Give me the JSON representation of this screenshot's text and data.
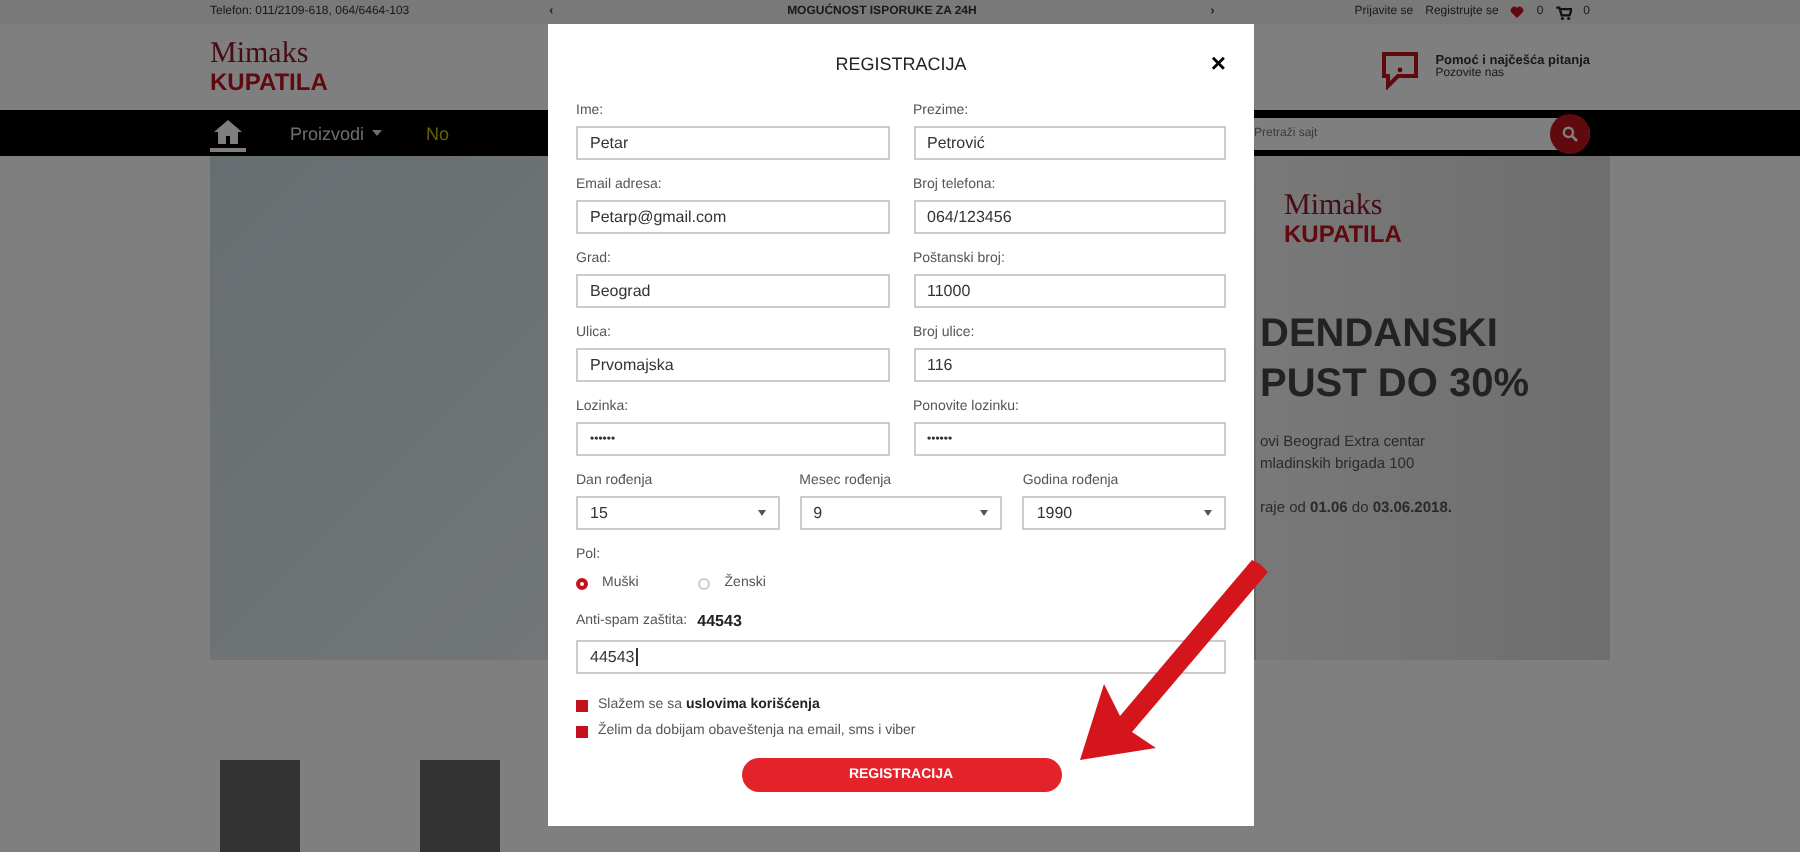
{
  "top_bar": {
    "phone": "Telefon: 011/2109-618, 064/6464-103",
    "prev": "‹",
    "notice": "MOGUĆNOST ISPORUKE ZA 24H",
    "next": "›",
    "login": "Prijavite se",
    "register": "Registrujte se",
    "wishlist_count": "0",
    "cart_count": "0"
  },
  "header": {
    "logo_line1": "Mimaks",
    "logo_line2": "KUPATILA",
    "help_title": "Pomoć i najčešća pitanja",
    "help_subtitle": "Pozovite nas"
  },
  "nav": {
    "items": [
      {
        "label": "Proizvodi",
        "dropdown": true
      },
      {
        "label": "No",
        "dropdown": false
      }
    ],
    "search_placeholder": "Pretraži sajt"
  },
  "banner": {
    "logo_line1": "Mimaks",
    "logo_line2": "KUPATILA",
    "headline": [
      "DENDANSKI",
      "PUST DO 30%"
    ],
    "address": [
      "ovi Beograd Extra centar",
      "mladinskih brigada 100"
    ],
    "dates": "raje od **01.06** do **03.06.2018.**"
  },
  "modal": {
    "title": "REGISTRACIJA",
    "close": "×",
    "fields": [
      {
        "label": "Ime:",
        "value": "Petar",
        "kind": "text"
      },
      {
        "label": "Prezime:",
        "value": "Petrović",
        "kind": "text"
      },
      {
        "label": "Email adresa:",
        "value": "Petarp@gmail.com",
        "kind": "text"
      },
      {
        "label": "Broj telefona:",
        "value": "064/123456",
        "kind": "text"
      },
      {
        "label": "Grad:",
        "value": "Beograd",
        "kind": "text"
      },
      {
        "label": "Poštanski broj:",
        "value": "11000",
        "kind": "text"
      },
      {
        "label": "Ulica:",
        "value": "Prvomajska",
        "kind": "text"
      },
      {
        "label": "Broj ulice:",
        "value": "116",
        "kind": "text"
      },
      {
        "label": "Lozinka:",
        "value": "••••••",
        "kind": "password"
      },
      {
        "label": "Ponovite lozinku:",
        "value": "••••••",
        "kind": "password"
      }
    ],
    "birth": [
      {
        "label": "Dan rođenja",
        "value": "15"
      },
      {
        "label": "Mesec rođenja",
        "value": "9"
      },
      {
        "label": "Godina rođenja",
        "value": "1990"
      }
    ],
    "gender": {
      "label": "Pol:",
      "options": [
        {
          "label": "Muški",
          "selected": true
        },
        {
          "label": "Ženski",
          "selected": false
        }
      ]
    },
    "antispam": {
      "label": "Anti-spam zaštita:",
      "code": "44543",
      "value": "44543"
    },
    "checkboxes": [
      {
        "text": "Slažem se sa **uslovima korišćenja**",
        "checked": true
      },
      {
        "text": "Želim da dobijam obaveštenja na email, sms i viber",
        "checked": true
      }
    ],
    "submit": "REGISTRACIJA"
  }
}
